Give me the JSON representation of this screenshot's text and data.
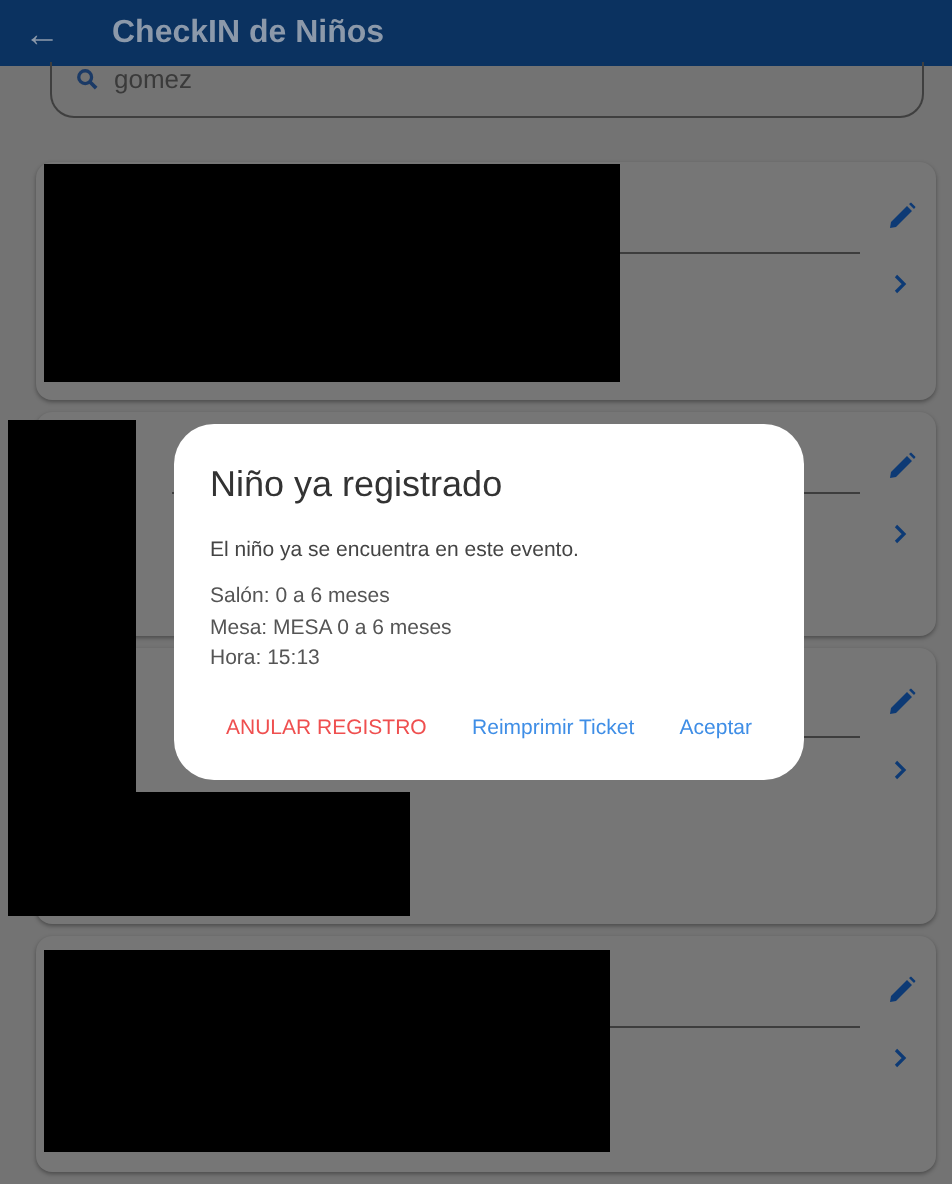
{
  "app_bar": {
    "back_icon": "←",
    "title": "CheckIN de Niños"
  },
  "search": {
    "value": "gomez"
  },
  "dialog": {
    "title": "Niño ya registrado",
    "message": "El niño ya se encuentra en este evento.",
    "details": [
      "Salón: 0 a 6 meses",
      "Mesa: MESA 0 a 6 meses",
      "Hora: 15:13"
    ],
    "buttons": [
      {
        "label": "ANULAR REGISTRO",
        "kind": "danger"
      },
      {
        "label": "Reimprimir Ticket",
        "kind": "normal"
      },
      {
        "label": "Aceptar",
        "kind": "normal"
      }
    ]
  }
}
